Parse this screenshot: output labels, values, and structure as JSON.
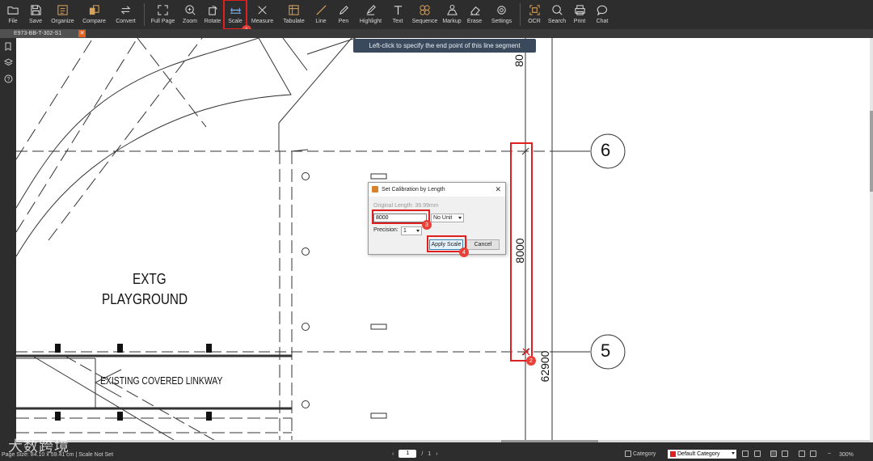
{
  "toolbar": {
    "items": [
      {
        "label": "File",
        "icon": "folder-icon"
      },
      {
        "label": "Save",
        "icon": "save-icon"
      },
      {
        "label": "Organize",
        "icon": "organize-icon"
      },
      {
        "label": "Compare",
        "icon": "compare-icon"
      },
      {
        "label": "Convert",
        "icon": "convert-icon"
      },
      {
        "label": "Full Page",
        "icon": "fullpage-icon"
      },
      {
        "label": "Zoom",
        "icon": "zoom-icon"
      },
      {
        "label": "Rotate",
        "icon": "rotate-icon"
      },
      {
        "label": "Scale",
        "icon": "scale-icon"
      },
      {
        "label": "Measure",
        "icon": "measure-icon"
      },
      {
        "label": "Tabulate",
        "icon": "tabulate-icon"
      },
      {
        "label": "Line",
        "icon": "line-icon"
      },
      {
        "label": "Pen",
        "icon": "pen-icon"
      },
      {
        "label": "Highlight",
        "icon": "highlight-icon"
      },
      {
        "label": "Text",
        "icon": "text-icon"
      },
      {
        "label": "Sequence",
        "icon": "sequence-icon"
      },
      {
        "label": "Markup",
        "icon": "markup-icon"
      },
      {
        "label": "Erase",
        "icon": "eraser-icon"
      },
      {
        "label": "Settings",
        "icon": "settings-icon"
      },
      {
        "label": "OCR",
        "icon": "ocr-icon"
      },
      {
        "label": "Search",
        "icon": "search-icon"
      },
      {
        "label": "Print",
        "icon": "print-icon"
      },
      {
        "label": "Chat",
        "icon": "chat-icon"
      }
    ],
    "accent": "#d9a25b"
  },
  "tab": {
    "name": "E973-BB-T-302-S1",
    "close": "✕"
  },
  "tooltip": "Left-click to specify the end point of this line segment",
  "drawing": {
    "label_playground_1": "EXTG",
    "label_playground_2": "PLAYGROUND",
    "label_linkway": "EXISTING COVERED LINKWAY",
    "grid_6": "6",
    "grid_5": "5",
    "dim_8000": "8000",
    "dim_top": "80",
    "dim_62900": "62900"
  },
  "dialog": {
    "title": "Set Calibration by Length",
    "close": "✕",
    "original_length": "Original Length: 39.99mm",
    "length_value": "8000",
    "unit": "No Unit",
    "precision_label": "Precision:",
    "precision_value": "1",
    "apply": "Apply Scale",
    "cancel": "Cancel"
  },
  "badges": {
    "b1": "1",
    "b2": "2",
    "b3": "3",
    "b4": "4"
  },
  "status": {
    "page_size": "Page Size: 84.10 x 59.41 cm",
    "scale": "Scale Not Set",
    "page_current": "1",
    "page_sep": "/",
    "page_total": "1",
    "category_label": "Category",
    "category_value": "Default Category",
    "zoom": "300%"
  },
  "watermark": "大数跨境",
  "colors": {
    "highlight": "#e02020",
    "badge": "#e8413a"
  }
}
